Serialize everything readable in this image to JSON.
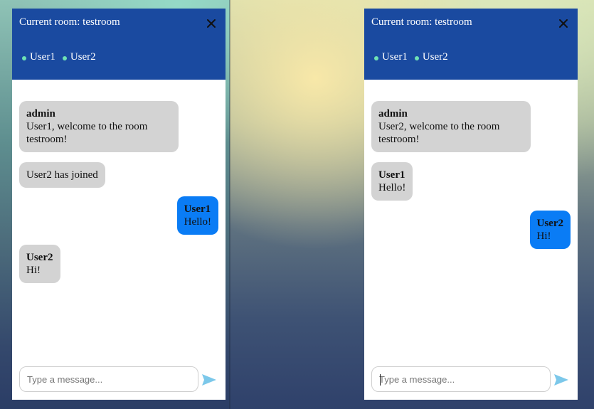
{
  "windows": [
    {
      "room_title": "Current room: testroom",
      "users": [
        "User1",
        "User2"
      ],
      "messages": [
        {
          "sender": "admin",
          "text": "User1, welcome to the room testroom!",
          "mine": false
        },
        {
          "sender": "",
          "text": "User2 has joined",
          "mine": false
        },
        {
          "sender": "User1",
          "text": "Hello!",
          "mine": true
        },
        {
          "sender": "User2",
          "text": "Hi!",
          "mine": false
        }
      ],
      "composer": {
        "placeholder": "Type a message...",
        "value": ""
      }
    },
    {
      "room_title": "Current room: testroom",
      "users": [
        "User1",
        "User2"
      ],
      "messages": [
        {
          "sender": "admin",
          "text": "User2, welcome to the room testroom!",
          "mine": false
        },
        {
          "sender": "User1",
          "text": "Hello!",
          "mine": false
        },
        {
          "sender": "User2",
          "text": "Hi!",
          "mine": true
        }
      ],
      "composer": {
        "placeholder": "Type a message...",
        "value": ""
      }
    }
  ],
  "colors": {
    "header": "#1a4aa0",
    "own_message": "#0a7cf5",
    "other_message": "#d3d3d3",
    "online_dot": "#6fe2b4",
    "send_icon": "#7cc8ea"
  },
  "icons": {
    "close": "close-icon",
    "send": "send-icon",
    "online": "online-dot-icon"
  }
}
